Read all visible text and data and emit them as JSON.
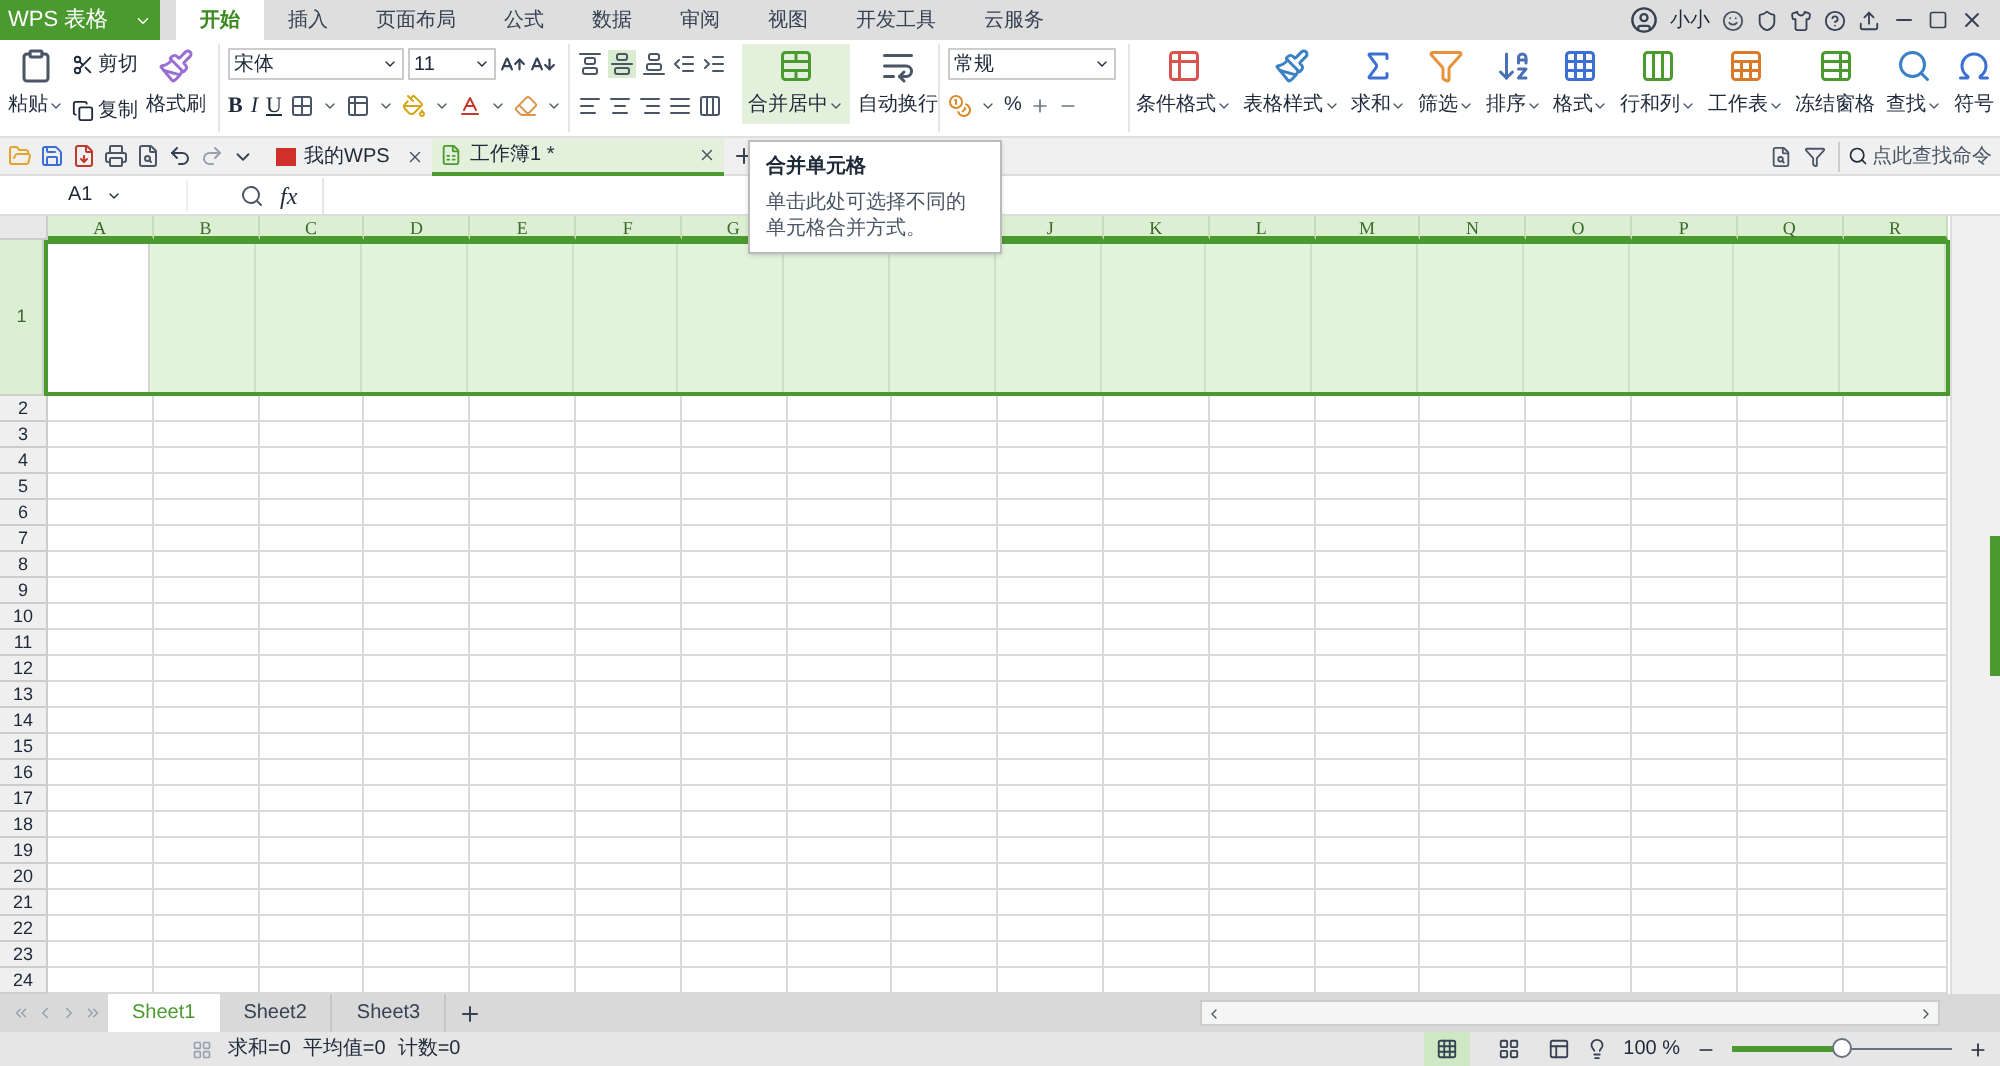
{
  "app_button": {
    "label": "WPS 表格"
  },
  "tabs": [
    {
      "label": "开始",
      "selected": true
    },
    {
      "label": "插入",
      "selected": false
    },
    {
      "label": "页面布局",
      "selected": false
    },
    {
      "label": "公式",
      "selected": false
    },
    {
      "label": "数据",
      "selected": false
    },
    {
      "label": "审阅",
      "selected": false
    },
    {
      "label": "视图",
      "selected": false
    },
    {
      "label": "开发工具",
      "selected": false
    },
    {
      "label": "云服务",
      "selected": false
    }
  ],
  "user": {
    "name": "小小"
  },
  "ribbon": {
    "paste": "粘贴",
    "cut": "剪切",
    "copy": "复制",
    "painter": "格式刷",
    "font_name": "宋体",
    "font_size": "11",
    "bold": "B",
    "italic": "I",
    "underline": "U",
    "merge": "合并居中",
    "wrap": "自动换行",
    "number_format": "常规",
    "percent": "%",
    "tools": [
      {
        "label": "条件格式",
        "dropdown": true
      },
      {
        "label": "表格样式",
        "dropdown": true
      },
      {
        "label": "求和",
        "dropdown": true
      },
      {
        "label": "筛选",
        "dropdown": true
      },
      {
        "label": "排序",
        "dropdown": true
      },
      {
        "label": "格式",
        "dropdown": true
      },
      {
        "label": "行和列",
        "dropdown": true
      },
      {
        "label": "工作表",
        "dropdown": true
      },
      {
        "label": "冻结窗格",
        "dropdown": false
      },
      {
        "label": "查找",
        "dropdown": true
      },
      {
        "label": "符号",
        "dropdown": false
      }
    ]
  },
  "doc_tabs": [
    {
      "label": "我的WPS",
      "selected": false
    },
    {
      "label": "工作簿1 *",
      "selected": true
    }
  ],
  "command_search": {
    "placeholder": "点此查找命令"
  },
  "tooltip": {
    "title": "合并单元格",
    "text": "单击此处可选择不同的单元格合并方式。"
  },
  "name_box": {
    "value": "A1"
  },
  "fx": "fx",
  "columns_left": [
    "A",
    "B",
    "C",
    "D",
    "E",
    "F",
    "G"
  ],
  "columns_right": [
    "J",
    "K",
    "L",
    "M",
    "N",
    "O",
    "P",
    "Q",
    "R"
  ],
  "rows": [
    {
      "label": "1",
      "selected": true
    },
    {
      "label": "2",
      "selected": false
    },
    {
      "label": "3",
      "selected": false
    },
    {
      "label": "4",
      "selected": false
    },
    {
      "label": "5",
      "selected": false
    },
    {
      "label": "6",
      "selected": false
    },
    {
      "label": "7",
      "selected": false
    },
    {
      "label": "8",
      "selected": false
    },
    {
      "label": "9",
      "selected": false
    },
    {
      "label": "10",
      "selected": false
    },
    {
      "label": "11",
      "selected": false
    },
    {
      "label": "12",
      "selected": false
    },
    {
      "label": "13",
      "selected": false
    },
    {
      "label": "14",
      "selected": false
    },
    {
      "label": "15",
      "selected": false
    },
    {
      "label": "16",
      "selected": false
    },
    {
      "label": "17",
      "selected": false
    },
    {
      "label": "18",
      "selected": false
    },
    {
      "label": "19",
      "selected": false
    },
    {
      "label": "20",
      "selected": false
    },
    {
      "label": "21",
      "selected": false
    },
    {
      "label": "22",
      "selected": false
    },
    {
      "label": "23",
      "selected": false
    },
    {
      "label": "24",
      "selected": false
    }
  ],
  "sheets": [
    {
      "label": "Sheet1",
      "selected": true
    },
    {
      "label": "Sheet2",
      "selected": false
    },
    {
      "label": "Sheet3",
      "selected": false
    }
  ],
  "status": [
    "求和=0",
    "平均值=0",
    "计数=0"
  ],
  "views": [
    {
      "selected": true
    },
    {
      "selected": false
    }
  ],
  "zoom": {
    "reading": "100 %",
    "level": 0.5
  }
}
